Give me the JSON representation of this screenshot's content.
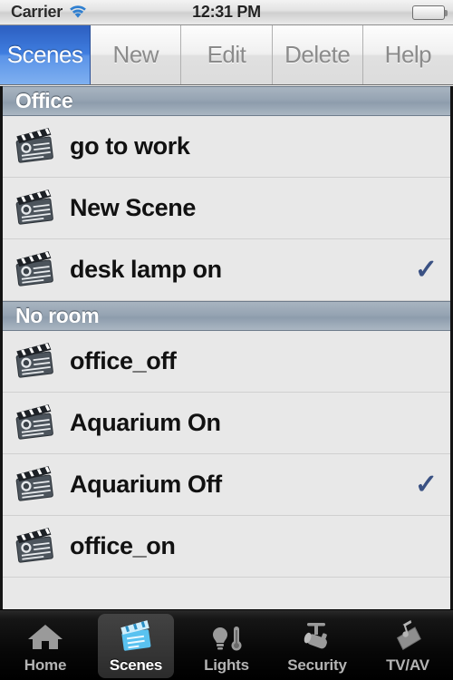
{
  "status_bar": {
    "carrier": "Carrier",
    "wifi_icon": "wifi-icon",
    "time": "12:31 PM",
    "battery_icon": "battery-icon"
  },
  "segmented_control": {
    "items": [
      {
        "label": "Scenes",
        "selected": true
      },
      {
        "label": "New",
        "selected": false
      },
      {
        "label": "Edit",
        "selected": false
      },
      {
        "label": "Delete",
        "selected": false
      },
      {
        "label": "Help",
        "selected": false
      }
    ]
  },
  "list": {
    "sections": [
      {
        "title": "Office",
        "rows": [
          {
            "label": "go to work",
            "icon": "clapperboard-icon",
            "checked": false
          },
          {
            "label": "New Scene",
            "icon": "clapperboard-icon",
            "checked": false
          },
          {
            "label": "desk lamp on",
            "icon": "clapperboard-icon",
            "checked": true
          }
        ]
      },
      {
        "title": "No room",
        "rows": [
          {
            "label": "office_off",
            "icon": "clapperboard-icon",
            "checked": false
          },
          {
            "label": "Aquarium On",
            "icon": "clapperboard-icon",
            "checked": false
          },
          {
            "label": "Aquarium Off",
            "icon": "clapperboard-icon",
            "checked": true
          },
          {
            "label": "office_on",
            "icon": "clapperboard-icon",
            "checked": false
          }
        ]
      }
    ],
    "checkmark_glyph": "✓"
  },
  "tab_bar": {
    "items": [
      {
        "label": "Home",
        "icon": "house-icon",
        "selected": false
      },
      {
        "label": "Scenes",
        "icon": "clapperboard-icon",
        "selected": true
      },
      {
        "label": "Lights",
        "icon": "lightbulb-thermometer-icon",
        "selected": false
      },
      {
        "label": "Security",
        "icon": "security-camera-icon",
        "selected": false
      },
      {
        "label": "TV/AV",
        "icon": "music-note-icon",
        "selected": false
      }
    ]
  },
  "colors": {
    "accent_blue": "#3f7ee0",
    "checkmark": "#3a5183",
    "section_header": "#96a4b3",
    "list_background": "#e8e8e8",
    "tabbar_background": "#0a0a0a",
    "battery_green": "#6fd016"
  }
}
